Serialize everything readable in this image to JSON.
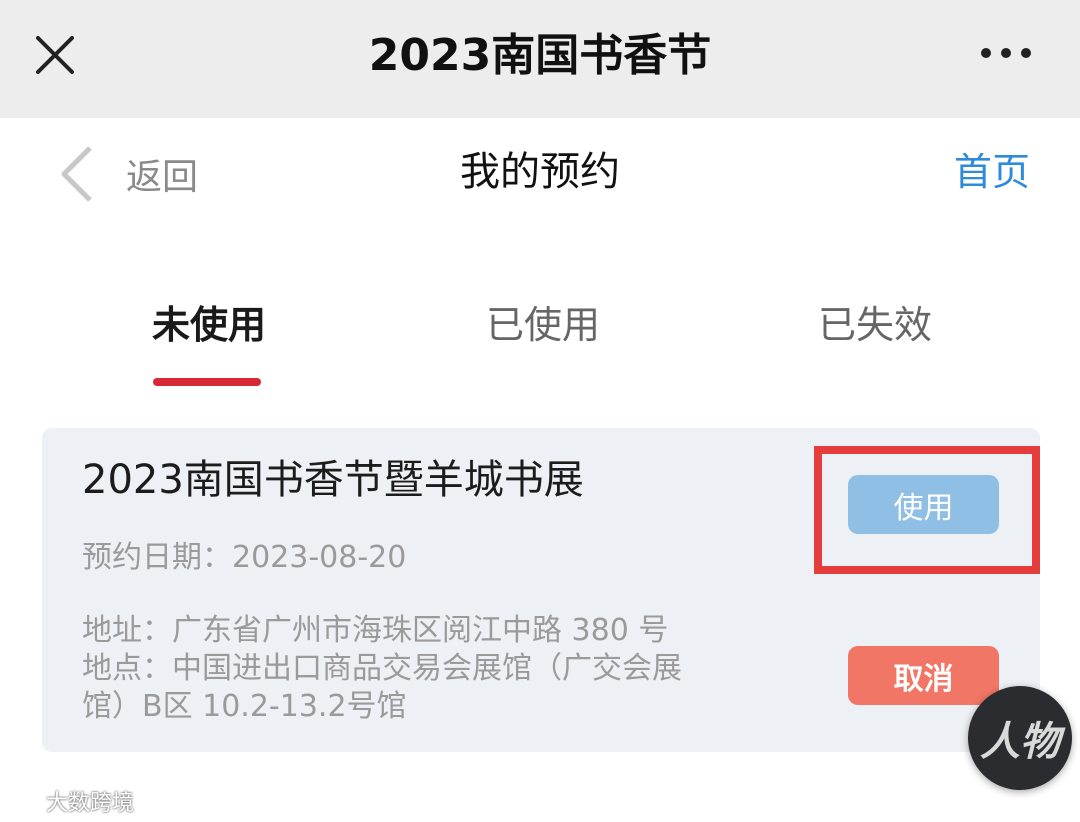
{
  "window": {
    "title": "2023南国书香节"
  },
  "nav": {
    "back_label": "返回",
    "page_title": "我的预约",
    "home_label": "首页"
  },
  "tabs": [
    {
      "label": "未使用",
      "active": true
    },
    {
      "label": "已使用",
      "active": false
    },
    {
      "label": "已失效",
      "active": false
    }
  ],
  "card": {
    "title": "2023南国书香节暨羊城书展",
    "date_label": "预约日期：",
    "date_value": "2023-08-20",
    "address_lines": [
      "地址：广东省广州市海珠区阅江中路 380 号",
      "地点：中国进出口商品交易会展馆（广交会展",
      "馆）B区 10.2-13.2号馆"
    ],
    "use_button": "使用",
    "cancel_button": "取消"
  },
  "overlay": {
    "logo_text": "人物",
    "watermark_text": "大数跨境"
  },
  "colors": {
    "accent_blue": "#2e8bd9",
    "tab_underline": "#d62837",
    "use_button": "#90bfe6",
    "cancel_button": "#f27666",
    "highlight": "#e53d3b"
  },
  "icons": [
    "close-icon",
    "more-icon",
    "back-chevron-icon",
    "weibo-icon"
  ]
}
